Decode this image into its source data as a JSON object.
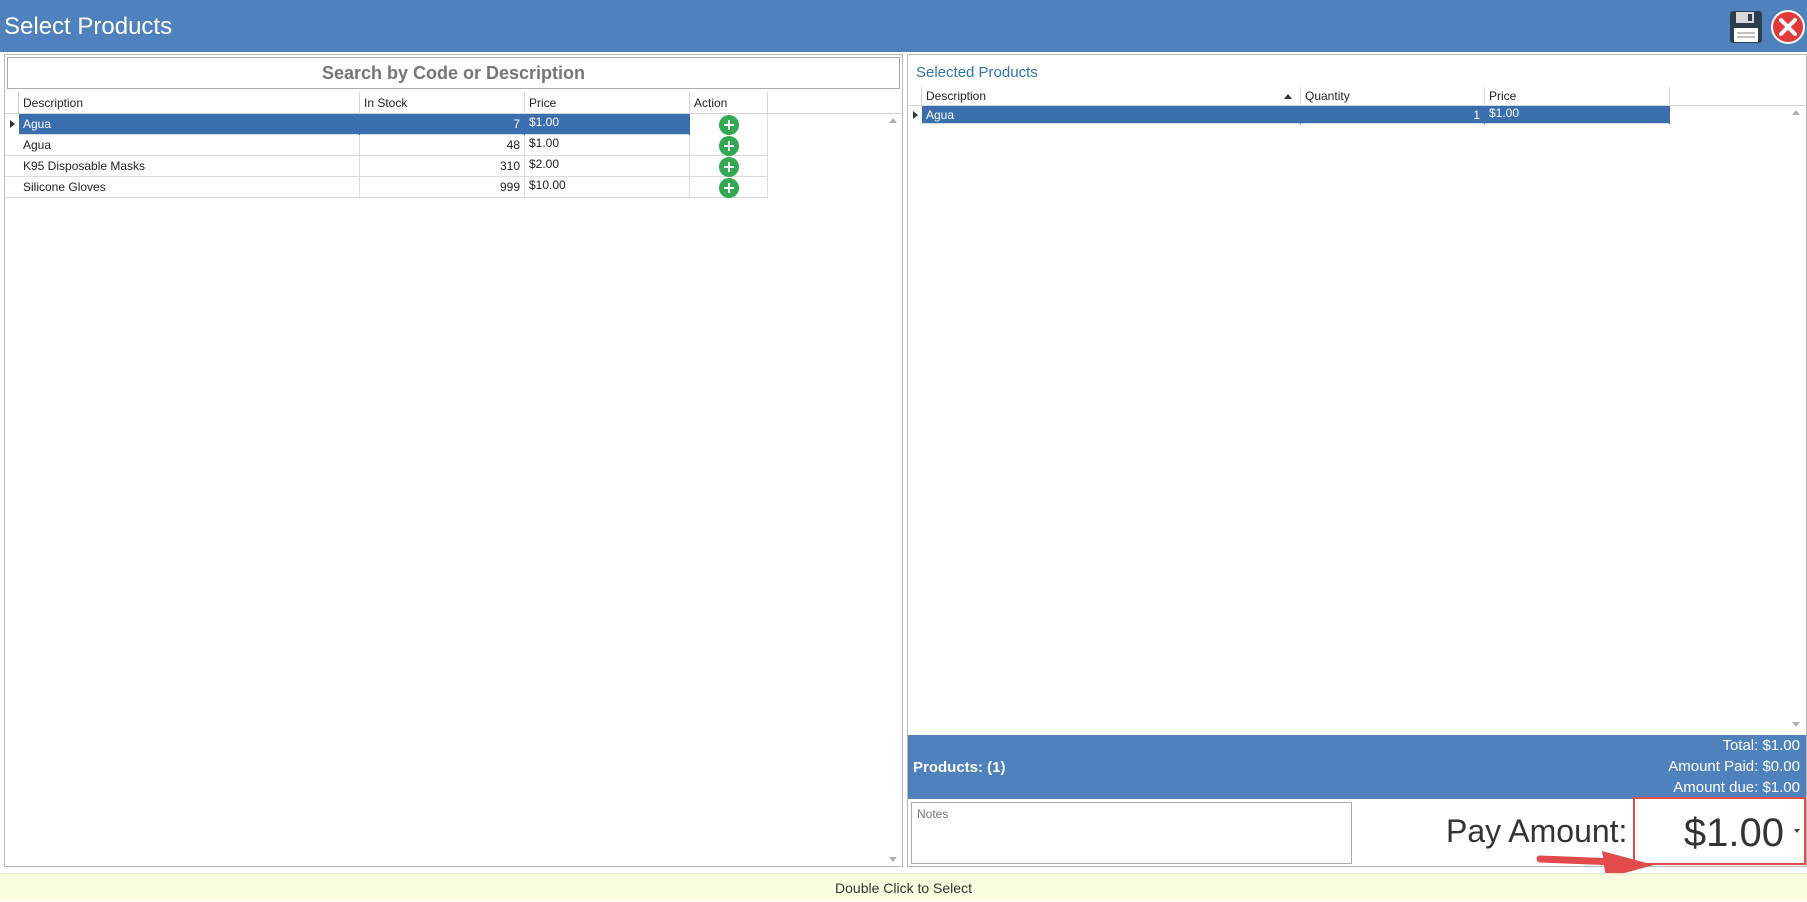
{
  "window": {
    "title": "Select Products",
    "save_icon": "floppy-disk-icon",
    "close_icon": "close-icon"
  },
  "search": {
    "placeholder": "Search by Code or Description"
  },
  "products_grid": {
    "columns": [
      "Description",
      "In Stock",
      "Price",
      "Action"
    ],
    "rows": [
      {
        "description": "Agua",
        "in_stock": "7",
        "price": "$1.00",
        "selected": true
      },
      {
        "description": "Agua",
        "in_stock": "48",
        "price": "$1.00",
        "selected": false
      },
      {
        "description": "K95 Disposable Masks",
        "in_stock": "310",
        "price": "$2.00",
        "selected": false
      },
      {
        "description": "Silicone Gloves",
        "in_stock": "999",
        "price": "$10.00",
        "selected": false
      }
    ]
  },
  "selected_products": {
    "title": "Selected Products",
    "columns": [
      "Description",
      "Quantity",
      "Price"
    ],
    "sort_column": "Description",
    "sort_direction": "ascending",
    "rows": [
      {
        "description": "Agua",
        "quantity": "1",
        "price": "$1.00",
        "selected": true
      }
    ]
  },
  "summary": {
    "products_count": "Products: (1)",
    "total": "Total: $1.00",
    "amount_paid": "Amount Paid: $0.00",
    "amount_due": "Amount due: $1.00"
  },
  "notes": {
    "placeholder": "Notes"
  },
  "payment": {
    "label": "Pay Amount:",
    "value": "$1.00"
  },
  "status": {
    "text": "Double Click to Select"
  },
  "colors": {
    "header": "#4f81bd",
    "selected_row": "#3a6eae",
    "add_button": "#33a853",
    "highlight": "#e24b4b",
    "status_bar": "#fdfde0"
  }
}
